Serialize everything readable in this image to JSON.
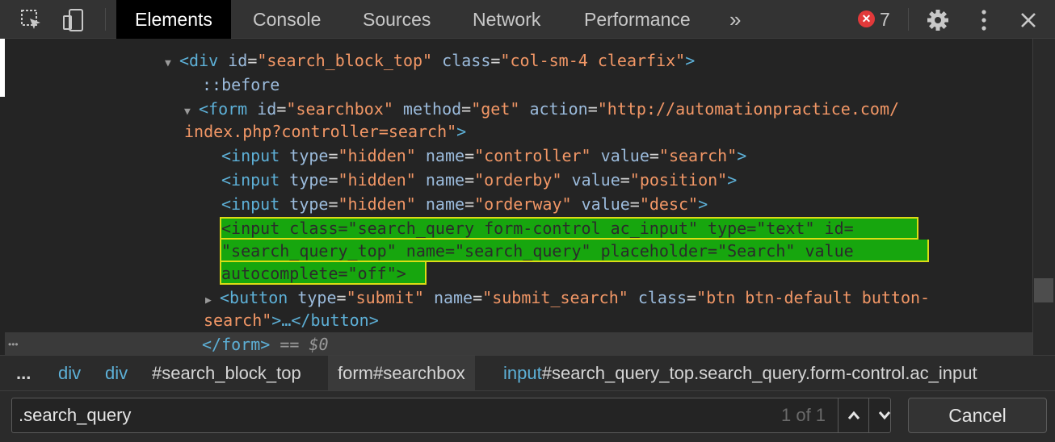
{
  "toolbar": {
    "tabs": [
      {
        "label": "Elements",
        "active": true
      },
      {
        "label": "Console"
      },
      {
        "label": "Sources"
      },
      {
        "label": "Network"
      },
      {
        "label": "Performance"
      }
    ],
    "more_label": "»",
    "error_count": "7",
    "icons": [
      "inspect-icon",
      "device-toggle-icon",
      "error-icon",
      "gear-icon",
      "kebab-menu-icon",
      "close-icon"
    ]
  },
  "code": {
    "l1": {
      "tag_open": "<div",
      "a1": "id",
      "v1": "\"search_block_top\"",
      "a2": "class",
      "v2": "\"col-sm-4 clearfix\"",
      "close": ">"
    },
    "l2": {
      "pseudo": "::before"
    },
    "l3": {
      "tag_open": "<form",
      "a1": "id",
      "v1": "\"searchbox\"",
      "a2": "method",
      "v2": "\"get\"",
      "a3": "action",
      "v3": "\"http://automationpractice.com/"
    },
    "l4": {
      "v": "index.php?controller=search\"",
      "close": ">"
    },
    "l5": {
      "tag_open": "<input",
      "a1": "type",
      "v1": "\"hidden\"",
      "a2": "name",
      "v2": "\"controller\"",
      "a3": "value",
      "v3": "\"search\"",
      "close": ">"
    },
    "l6": {
      "tag_open": "<input",
      "a1": "type",
      "v1": "\"hidden\"",
      "a2": "name",
      "v2": "\"orderby\"",
      "a3": "value",
      "v3": "\"position\"",
      "close": ">"
    },
    "l7": {
      "tag_open": "<input",
      "a1": "type",
      "v1": "\"hidden\"",
      "a2": "name",
      "v2": "\"orderway\"",
      "a3": "value",
      "v3": "\"desc\"",
      "close": ">"
    },
    "hl": [
      "<input class=\"search_query form-control ac_input\" type=\"text\" id=",
      "\"search_query_top\" name=\"search_query\" placeholder=\"Search\" value",
      "autocomplete=\"off\">"
    ],
    "l8": {
      "tag_open": "<button",
      "a1": "type",
      "v1": "\"submit\"",
      "a2": "name",
      "v2": "\"submit_search\"",
      "a3": "class",
      "v3": "\"btn btn-default button-"
    },
    "l9": {
      "v": "search\"",
      "close": ">…</button>"
    },
    "l10": {
      "tag": "</form>",
      "eq": " == ",
      "dollar": "$0"
    }
  },
  "row_dots": "•••",
  "breadcrumbs": {
    "ellipsis": "...",
    "items": [
      {
        "tag": "div",
        "rest": ""
      },
      {
        "tag": "div",
        "rest": ""
      },
      {
        "tag": "",
        "rest": "#search_block_top"
      },
      {
        "tag": "",
        "rest": "form#searchbox",
        "selected": true
      },
      {
        "tag": "input",
        "rest": "#search_query_top.search_query.form-control.ac_input"
      }
    ]
  },
  "search": {
    "value": ".search_query",
    "match_count": "1 of 1",
    "cancel_label": "Cancel"
  },
  "colors": {
    "highlight": "#17a60e",
    "highlight_border": "#dcdc14",
    "error": "#e2393a",
    "tag": "#5db0d7",
    "value": "#f29766"
  }
}
